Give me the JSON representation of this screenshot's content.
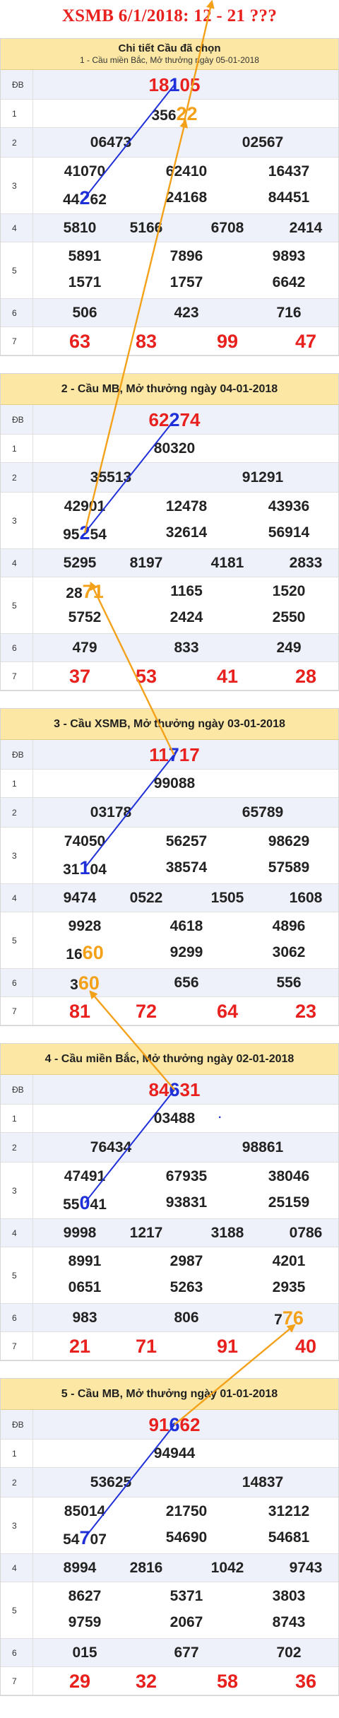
{
  "page": {
    "title": "XSMB 6/1/2018: 12 - 21 ???"
  },
  "sections": [
    {
      "header_line1": "Chi tiết Cầu đã chọn",
      "header_line2": "1 - Cầu miền Bắc, Mở thưởng ngày 05-01-2018",
      "rows": [
        {
          "label": "ĐB",
          "numbers": [
            "18105"
          ]
        },
        {
          "label": "1",
          "numbers": [
            "35622"
          ]
        },
        {
          "label": "2",
          "numbers": [
            "06473",
            "02567"
          ]
        },
        {
          "label": "3",
          "numbers": [
            "41070",
            "62410",
            "16437",
            "44262",
            "24168",
            "84451"
          ]
        },
        {
          "label": "4",
          "numbers": [
            "5810",
            "5166",
            "6708",
            "2414"
          ]
        },
        {
          "label": "5",
          "numbers": [
            "5891",
            "7896",
            "9893",
            "1571",
            "1757",
            "6642"
          ]
        },
        {
          "label": "6",
          "numbers": [
            "506",
            "423",
            "716"
          ]
        },
        {
          "label": "7",
          "numbers": [
            "63",
            "83",
            "99",
            "47"
          ]
        }
      ]
    },
    {
      "header_line1": "2 - Cầu MB, Mở thưởng ngày 04-01-2018",
      "header_line2": "",
      "rows": [
        {
          "label": "ĐB",
          "numbers": [
            "62274"
          ]
        },
        {
          "label": "1",
          "numbers": [
            "80320"
          ]
        },
        {
          "label": "2",
          "numbers": [
            "35513",
            "91291"
          ]
        },
        {
          "label": "3",
          "numbers": [
            "42901",
            "12478",
            "43936",
            "95254",
            "32614",
            "56914"
          ]
        },
        {
          "label": "4",
          "numbers": [
            "5295",
            "8197",
            "4181",
            "2833"
          ]
        },
        {
          "label": "5",
          "numbers": [
            "2871",
            "1165",
            "1520",
            "5752",
            "2424",
            "2550"
          ]
        },
        {
          "label": "6",
          "numbers": [
            "479",
            "833",
            "249"
          ]
        },
        {
          "label": "7",
          "numbers": [
            "37",
            "53",
            "41",
            "28"
          ]
        }
      ]
    },
    {
      "header_line1": "3 - Cầu XSMB, Mở thưởng ngày 03-01-2018",
      "header_line2": "",
      "rows": [
        {
          "label": "ĐB",
          "numbers": [
            "11717"
          ]
        },
        {
          "label": "1",
          "numbers": [
            "99088"
          ]
        },
        {
          "label": "2",
          "numbers": [
            "03178",
            "65789"
          ]
        },
        {
          "label": "3",
          "numbers": [
            "74050",
            "56257",
            "98629",
            "31104",
            "38574",
            "57589"
          ]
        },
        {
          "label": "4",
          "numbers": [
            "9474",
            "0522",
            "1505",
            "1608"
          ]
        },
        {
          "label": "5",
          "numbers": [
            "9928",
            "4618",
            "4896",
            "1660",
            "9299",
            "3062"
          ]
        },
        {
          "label": "6",
          "numbers": [
            "360",
            "656",
            "556"
          ]
        },
        {
          "label": "7",
          "numbers": [
            "81",
            "72",
            "64",
            "23"
          ]
        }
      ]
    },
    {
      "header_line1": "4 - Cầu miền Bắc, Mở thưởng ngày 02-01-2018",
      "header_line2": "",
      "rows": [
        {
          "label": "ĐB",
          "numbers": [
            "84631"
          ]
        },
        {
          "label": "1",
          "numbers": [
            "03488"
          ]
        },
        {
          "label": "2",
          "numbers": [
            "76434",
            "98861"
          ]
        },
        {
          "label": "3",
          "numbers": [
            "47491",
            "67935",
            "38046",
            "55041",
            "93831",
            "25159"
          ]
        },
        {
          "label": "4",
          "numbers": [
            "9998",
            "1217",
            "3188",
            "0786"
          ]
        },
        {
          "label": "5",
          "numbers": [
            "8991",
            "2987",
            "4201",
            "0651",
            "5263",
            "2935"
          ]
        },
        {
          "label": "6",
          "numbers": [
            "983",
            "806",
            "776"
          ]
        },
        {
          "label": "7",
          "numbers": [
            "21",
            "71",
            "91",
            "40"
          ]
        }
      ]
    },
    {
      "header_line1": "5 - Cầu MB, Mở thưởng ngày 01-01-2018",
      "header_line2": "",
      "rows": [
        {
          "label": "ĐB",
          "numbers": [
            "91662"
          ]
        },
        {
          "label": "1",
          "numbers": [
            "94944"
          ]
        },
        {
          "label": "2",
          "numbers": [
            "53625",
            "14837"
          ]
        },
        {
          "label": "3",
          "numbers": [
            "85014",
            "21750",
            "31212",
            "54707",
            "54690",
            "54681"
          ]
        },
        {
          "label": "4",
          "numbers": [
            "8994",
            "2816",
            "1042",
            "9743"
          ]
        },
        {
          "label": "5",
          "numbers": [
            "8627",
            "5371",
            "3803",
            "9759",
            "2067",
            "8743"
          ]
        },
        {
          "label": "6",
          "numbers": [
            "015",
            "677",
            "702"
          ]
        },
        {
          "label": "7",
          "numbers": [
            "29",
            "32",
            "58",
            "36"
          ]
        }
      ]
    }
  ],
  "highlights": {
    "blue": "#1f30d8",
    "orange": "#f4a11a",
    "red": "#e8211e"
  },
  "stray_mark": "."
}
